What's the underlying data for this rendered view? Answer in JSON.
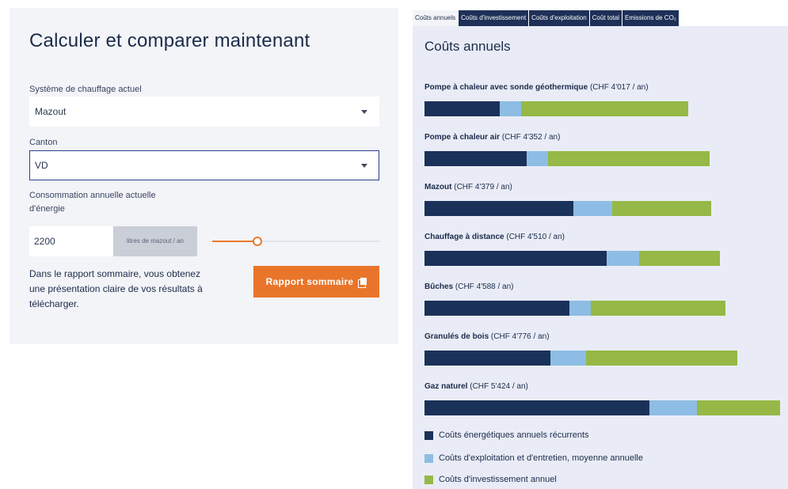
{
  "calculator": {
    "title": "Calculer et comparer maintenant",
    "heating_label": "Système de chauffage actuel",
    "heating_value": "Mazout",
    "canton_label": "Canton",
    "canton_value": "VD",
    "consumption_label_1": "Consommation annuelle actuelle",
    "consumption_label_2": "d'énergie",
    "consumption_value": "2200",
    "unit_label": "litres de mazout / an",
    "slider_fraction": 0.27,
    "report_text": "Dans le rapport sommaire, vous obtenez une présentation claire de vos résultats à télécharger.",
    "report_button": "Rapport sommaire",
    "colors": {
      "accent": "#e9752b",
      "navy": "#1c2b4a"
    }
  },
  "tabs": [
    {
      "label": "Coûts annuels",
      "active": true
    },
    {
      "label": "Coûts d'investissement",
      "active": false
    },
    {
      "label": "Coûts d'exploitation",
      "active": false
    },
    {
      "label": "Coût total",
      "active": false
    },
    {
      "label": "Emissions de CO₂",
      "active": false
    }
  ],
  "chart_data": {
    "type": "bar",
    "orientation": "horizontal",
    "stacked": true,
    "title": "Coûts annuels",
    "categories": [
      {
        "name": "Pompe à chaleur avec sonde géothermique",
        "total": "(CHF 4'017 / an)"
      },
      {
        "name": "Pompe à chaleur air",
        "total": "(CHF 4'352 / an)"
      },
      {
        "name": "Mazout",
        "total": "(CHF 4'379 / an)"
      },
      {
        "name": "Chauffage à distance",
        "total": "(CHF 4'510 / an)"
      },
      {
        "name": "Bûches",
        "total": "(CHF 4'588 / an)"
      },
      {
        "name": "Granulés de bois",
        "total": "(CHF 4'776 / an)"
      },
      {
        "name": "Gaz naturel",
        "total": "(CHF 5'424 / an)"
      }
    ],
    "series": [
      {
        "name": "Coûts énergétiques annuels récurrents",
        "color": "#1a3159",
        "values": [
          1148,
          1560,
          2270,
          2780,
          2210,
          1920,
          3430
        ]
      },
      {
        "name": "Coûts d'exploitation et d'entretien, moyenne annuelle",
        "color": "#8dbde4",
        "values": [
          325,
          325,
          595,
          495,
          325,
          545,
          725
        ]
      },
      {
        "name": "Coûts d'investissement annuel",
        "color": "#95b846",
        "values": [
          2544,
          2467,
          1514,
          1235,
          2053,
          2311,
          1269
        ]
      }
    ],
    "xlim": [
      0,
      5424
    ]
  }
}
